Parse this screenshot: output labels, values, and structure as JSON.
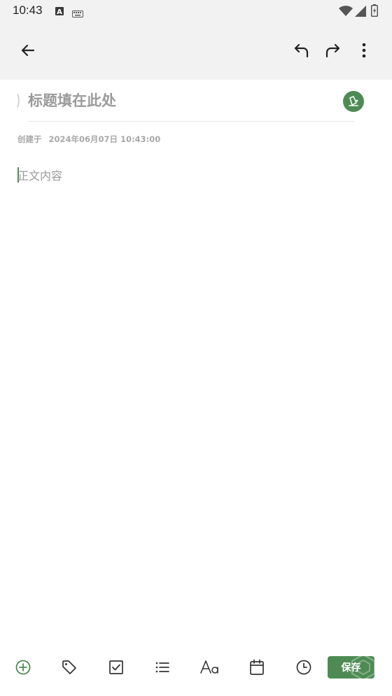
{
  "status_bar": {
    "time": "10:43",
    "icons": [
      "a-box-icon",
      "keyboard-icon",
      "wifi-icon",
      "signal-icon",
      "battery-icon"
    ]
  },
  "toolbar": {
    "icons": [
      "back-arrow-icon",
      "undo-icon",
      "redo-icon",
      "more-vertical-icon"
    ]
  },
  "note": {
    "title_placeholder": "标题填在此处",
    "created_label": "创建于",
    "created_time": "2024年06月07日 10:43:00",
    "body_placeholder": "正文内容"
  },
  "bottom_toolbar": {
    "icons": [
      "add-circle-icon",
      "tag-icon",
      "checkbox-icon",
      "list-icon",
      "text-format-icon",
      "calendar-icon",
      "clock-icon"
    ],
    "save_label": "保存"
  },
  "colors": {
    "accent": "#4e8b54",
    "bar_background": "#f2f2f2",
    "placeholder": "#9a9a9a"
  }
}
